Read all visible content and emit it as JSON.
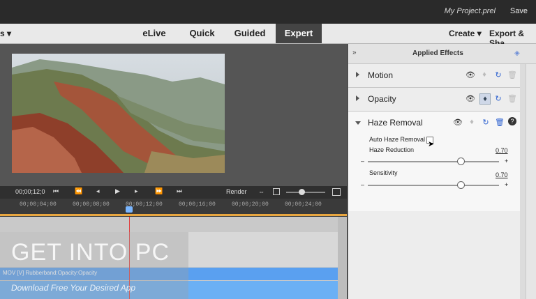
{
  "titlebar": {
    "project": "My Project.prel",
    "save": "Save"
  },
  "menubar": {
    "left_label": "s",
    "tabs": [
      {
        "label": "eLive"
      },
      {
        "label": "Quick"
      },
      {
        "label": "Guided"
      },
      {
        "label": "Expert",
        "active": true
      }
    ],
    "create": "Create",
    "export": "Export & Sha"
  },
  "transport": {
    "timecode": "00;00;12;0",
    "render": "Render"
  },
  "ruler": {
    "times": [
      "00;00;04;00",
      "00;00;08;00",
      "00;00;12;00",
      "00;00;16;00",
      "00;00;20;00",
      "00;00;24;00"
    ]
  },
  "track": {
    "clip_label": "MOV [V] Rubberband:Opacity:Opacity"
  },
  "panel": {
    "title": "Applied Effects",
    "effects": [
      {
        "name": "Motion"
      },
      {
        "name": "Opacity"
      },
      {
        "name": "Haze Removal"
      }
    ],
    "haze": {
      "auto_label": "Auto Haze Removal",
      "reduction_label": "Haze Reduction",
      "reduction_value": "0.70",
      "sensitivity_label": "Sensitivity",
      "sensitivity_value": "0.70",
      "minus": "–",
      "plus": "+"
    }
  },
  "watermark": {
    "title": "GET INTO PC",
    "subtitle": "Download Free Your Desired App"
  },
  "colors": {
    "accent": "#4a6fd6",
    "active_tab": "#444444",
    "playhead": "#e04040"
  }
}
